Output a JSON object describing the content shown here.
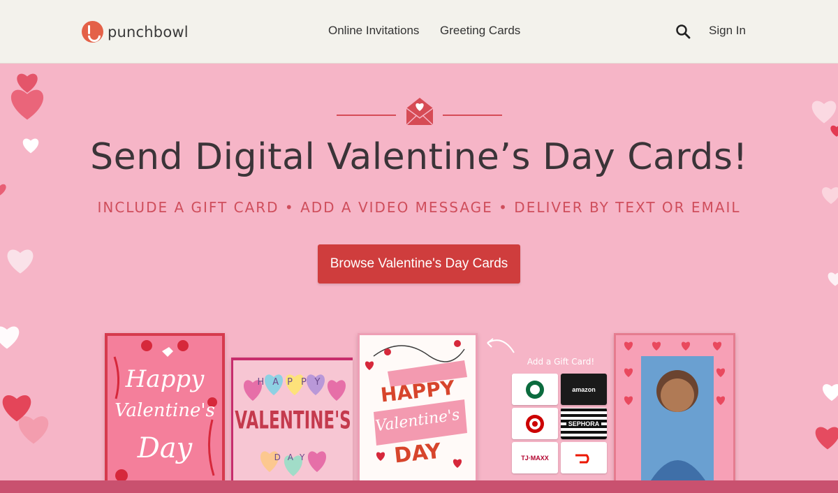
{
  "header": {
    "logo_text": "punchbowl",
    "nav": [
      {
        "label": "Online Invitations"
      },
      {
        "label": "Greeting Cards"
      }
    ],
    "search_icon": "search-icon",
    "sign_in": "Sign In"
  },
  "hero": {
    "title": "Send Digital Valentine’s Day Cards!",
    "subtitle": "INCLUDE A GIFT CARD • ADD A VIDEO MESSAGE • DELIVER BY TEXT OR EMAIL",
    "cta_label": "Browse Valentine's Day Cards",
    "envelope_icon": "envelope-heart-icon"
  },
  "cards": {
    "card1": {
      "line1": "Happy",
      "line2": "Valentine's",
      "line3": "Day"
    },
    "card2": {
      "line1": "HAPPY",
      "line2": "VALENTINE'S",
      "line3": "DAY"
    },
    "card3": {
      "line1": "HAPPY",
      "line2": "Valentine's",
      "line3": "DAY"
    },
    "gift": {
      "label": "Add a Gift Card!",
      "brands": [
        "Starbucks",
        "amazon",
        "Target",
        "SEPHORA",
        "TJ·MAXX",
        "DoorDash"
      ]
    }
  },
  "colors": {
    "header_bg": "#f3f2ec",
    "hero_bg": "#f6b5c7",
    "accent": "#cf3d3d",
    "subtitle": "#cf4e5c"
  }
}
